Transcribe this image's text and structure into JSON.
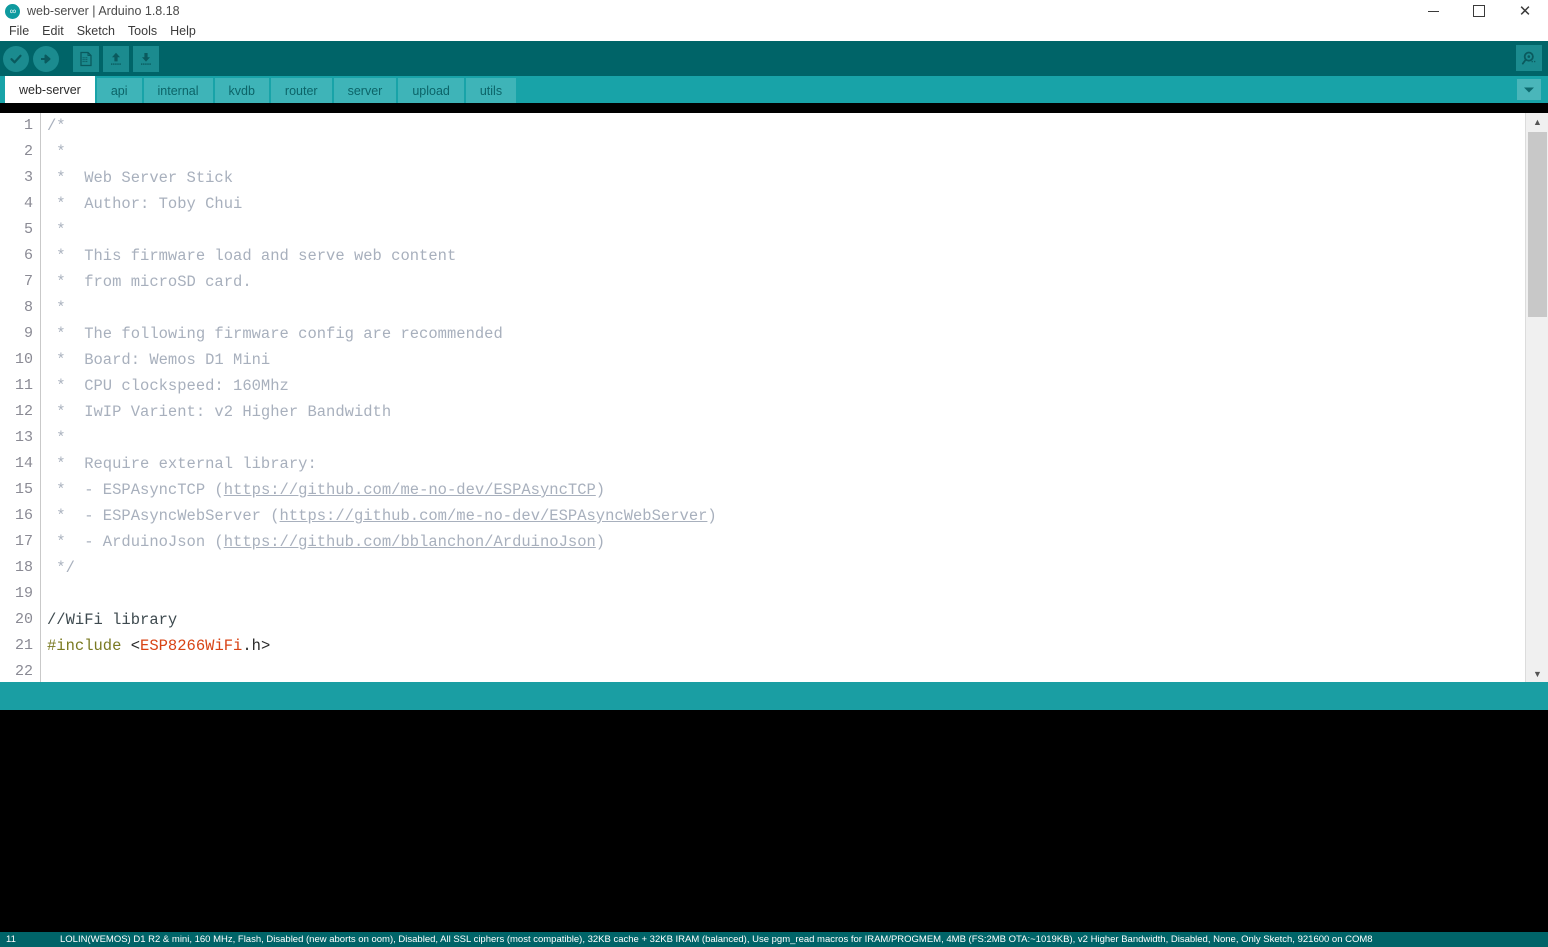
{
  "window": {
    "title": "web-server | Arduino 1.8.18",
    "app_icon": "arduino-logo-icon",
    "minimize_label": "—",
    "maximize_label": "□",
    "close_label": "✕"
  },
  "menubar": {
    "items": [
      {
        "label": "File"
      },
      {
        "label": "Edit"
      },
      {
        "label": "Sketch"
      },
      {
        "label": "Tools"
      },
      {
        "label": "Help"
      }
    ]
  },
  "toolbar": {
    "verify_label": "Verify",
    "upload_label": "Upload",
    "new_label": "New",
    "open_label": "Open",
    "save_label": "Save",
    "serial_monitor_label": "Serial Monitor"
  },
  "tabs": {
    "items": [
      {
        "label": "web-server",
        "active": true
      },
      {
        "label": "api",
        "active": false
      },
      {
        "label": "internal",
        "active": false
      },
      {
        "label": "kvdb",
        "active": false
      },
      {
        "label": "router",
        "active": false
      },
      {
        "label": "server",
        "active": false
      },
      {
        "label": "upload",
        "active": false
      },
      {
        "label": "utils",
        "active": false
      }
    ],
    "menu_button_label": "▼"
  },
  "editor": {
    "line_numbers": [
      "1",
      "2",
      "3",
      "4",
      "5",
      "6",
      "7",
      "8",
      "9",
      "10",
      "11",
      "12",
      "13",
      "14",
      "15",
      "16",
      "17",
      "18",
      "19",
      "20",
      "21",
      "22"
    ],
    "lines": [
      {
        "n": "1",
        "text": "/*"
      },
      {
        "n": "2",
        "text": " *"
      },
      {
        "n": "3",
        "text": " *  Web Server Stick"
      },
      {
        "n": "4",
        "text": " *  Author: Toby Chui"
      },
      {
        "n": "5",
        "text": " *"
      },
      {
        "n": "6",
        "text": " *  This firmware load and serve web content"
      },
      {
        "n": "7",
        "text": " *  from microSD card."
      },
      {
        "n": "8",
        "text": " *"
      },
      {
        "n": "9",
        "text": " *  The following firmware config are recommended"
      },
      {
        "n": "10",
        "text": " *  Board: Wemos D1 Mini"
      },
      {
        "n": "11",
        "text": " *  CPU clockspeed: 160Mhz"
      },
      {
        "n": "12",
        "text": " *  IwIP Varient: v2 Higher Bandwidth"
      },
      {
        "n": "13",
        "text": " *"
      },
      {
        "n": "14",
        "text": " *  Require external library:"
      },
      {
        "n": "15",
        "pre": " *  - ESPAsyncTCP (",
        "link": "https://github.com/me-no-dev/ESPAsyncTCP",
        "post": ")"
      },
      {
        "n": "16",
        "pre": " *  - ESPAsyncWebServer (",
        "link": "https://github.com/me-no-dev/ESPAsyncWebServer",
        "post": ")"
      },
      {
        "n": "17",
        "pre": " *  - ArduinoJson (",
        "link": "https://github.com/bblanchon/ArduinoJson",
        "post": ")"
      },
      {
        "n": "18",
        "text": " */"
      },
      {
        "n": "19",
        "text": ""
      },
      {
        "n": "20",
        "text": "//WiFi library"
      },
      {
        "n": "21",
        "include_kw": "#include",
        "include_open": " <",
        "include_lib": "ESP8266WiFi",
        "include_ext": ".h",
        "include_close": ">"
      },
      {
        "n": "22",
        "text": ""
      }
    ],
    "colors": {
      "comment": "#a8b0bd",
      "line_comment": "#3e4a4f",
      "preprocessor": "#7a7a22",
      "string": "#d84315",
      "plain": "#2a2a2a",
      "gutter": "#8a8a94"
    },
    "scroll": {
      "up_arrow": "▲",
      "down_arrow": "▼"
    }
  },
  "statusbar": {
    "cursor_line": "11",
    "board_info": "LOLIN(WEMOS) D1 R2 & mini, 160 MHz, Flash, Disabled (new aborts on oom), Disabled, All SSL ciphers (most compatible), 32KB cache + 32KB IRAM (balanced), Use pgm_read macros for IRAM/PROGMEM, 4MB (FS:2MB OTA:~1019KB), v2 Higher Bandwidth, Disabled, None, Only Sketch, 921600 on COM8"
  },
  "theme": {
    "toolbar_bg": "#006468",
    "tabstrip_bg": "#18a3a8",
    "status_band_bg": "#1a9ea3",
    "console_bg": "#000000",
    "accent": "#1b8b8f"
  }
}
